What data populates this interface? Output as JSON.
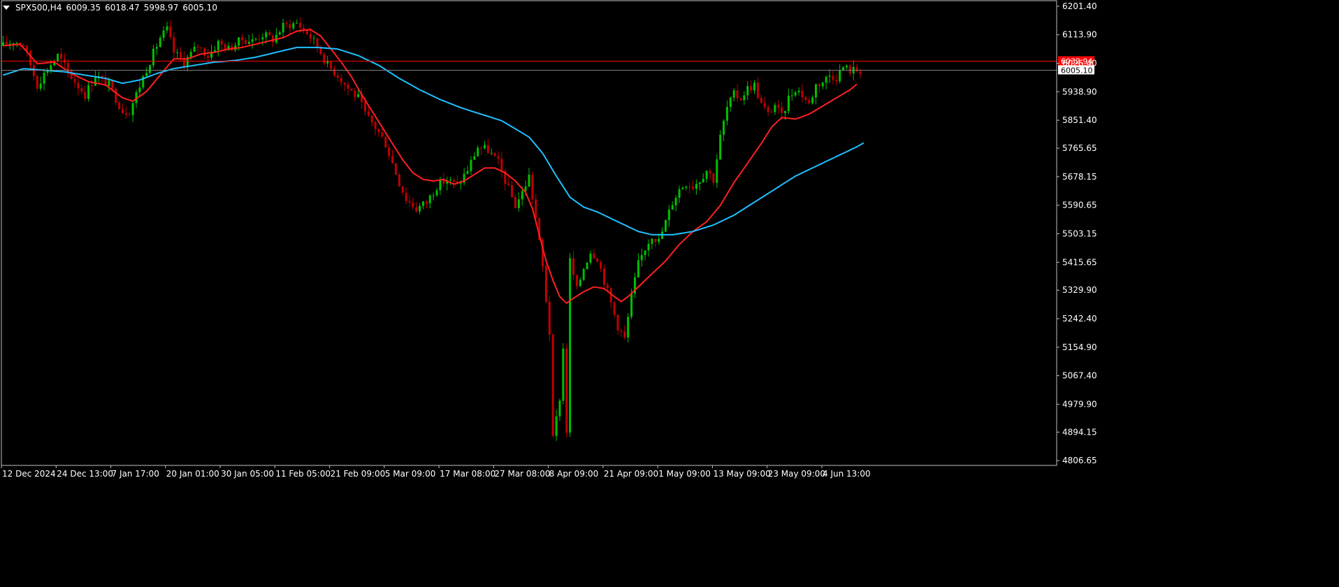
{
  "header": {
    "symbol": "SPX500,H4",
    "open": "6009.35",
    "high": "6018.47",
    "low": "5998.97",
    "close": "6005.10"
  },
  "colors": {
    "background": "#000000",
    "axis": "#c0c0c0",
    "candle_up": "#00c000",
    "candle_down": "#c00000",
    "ma_fast": "#ff2020",
    "ma_slow": "#20c0ff",
    "level_line": "#ff0000",
    "price_line": "#808080",
    "level_label_bg": "#ff0000",
    "price_label_bg": "#ffffff"
  },
  "chart_data": {
    "type": "line",
    "title": "",
    "y_ticks": [
      "6201.40",
      "6113.90",
      "6026.40",
      "5938.90",
      "5851.40",
      "5765.65",
      "5678.15",
      "5590.65",
      "5503.15",
      "5415.65",
      "5329.90",
      "5242.40",
      "5154.90",
      "5067.40",
      "4979.90",
      "4894.15",
      "4806.65"
    ],
    "ylim": [
      4792,
      6212
    ],
    "x_ticks": [
      "12 Dec 2024",
      "24 Dec 13:00",
      "7 Jan 17:00",
      "20 Jan 01:00",
      "30 Jan 05:00",
      "11 Feb 05:00",
      "21 Feb 09:00",
      "5 Mar 09:00",
      "17 Mar 08:00",
      "27 Mar 08:00",
      "8 Apr 09:00",
      "21 Apr 09:00",
      "1 May 09:00",
      "13 May 09:00",
      "23 May 09:00",
      "4 Jun 13:00"
    ],
    "horizontal_levels": [
      {
        "name": "level",
        "value": 6032.94,
        "label": "6032.94"
      },
      {
        "name": "bid",
        "value": 6005.1,
        "label": "6005.10"
      }
    ],
    "price_close_keypoints": [
      [
        0,
        6080
      ],
      [
        3,
        6095
      ],
      [
        6,
        6085
      ],
      [
        10,
        5960
      ],
      [
        13,
        6010
      ],
      [
        16,
        6050
      ],
      [
        20,
        5985
      ],
      [
        24,
        5930
      ],
      [
        27,
        5990
      ],
      [
        31,
        5960
      ],
      [
        35,
        5880
      ],
      [
        37,
        5880
      ],
      [
        42,
        6010
      ],
      [
        46,
        6105
      ],
      [
        48,
        6130
      ],
      [
        50,
        6060
      ],
      [
        53,
        6030
      ],
      [
        57,
        6080
      ],
      [
        60,
        6050
      ],
      [
        63,
        6090
      ],
      [
        66,
        6070
      ],
      [
        70,
        6100
      ],
      [
        73,
        6095
      ],
      [
        76,
        6115
      ],
      [
        79,
        6100
      ],
      [
        82,
        6140
      ],
      [
        86,
        6150
      ],
      [
        89,
        6120
      ],
      [
        92,
        6080
      ],
      [
        95,
        6020
      ],
      [
        98,
        5990
      ],
      [
        101,
        5950
      ],
      [
        104,
        5920
      ],
      [
        106,
        5870
      ],
      [
        109,
        5830
      ],
      [
        112,
        5780
      ],
      [
        114,
        5720
      ],
      [
        116,
        5660
      ],
      [
        118,
        5610
      ],
      [
        121,
        5580
      ],
      [
        124,
        5600
      ],
      [
        127,
        5650
      ],
      [
        130,
        5670
      ],
      [
        133,
        5650
      ],
      [
        136,
        5700
      ],
      [
        139,
        5770
      ],
      [
        142,
        5760
      ],
      [
        145,
        5720
      ],
      [
        148,
        5640
      ],
      [
        150,
        5590
      ],
      [
        152,
        5630
      ],
      [
        154,
        5680
      ],
      [
        156,
        5550
      ],
      [
        158,
        5400
      ],
      [
        160,
        5200
      ],
      [
        161,
        4870
      ],
      [
        163,
        5000
      ],
      [
        164,
        5150
      ],
      [
        165,
        4900
      ],
      [
        166,
        5420
      ],
      [
        168,
        5330
      ],
      [
        170,
        5400
      ],
      [
        172,
        5450
      ],
      [
        174,
        5430
      ],
      [
        176,
        5360
      ],
      [
        178,
        5290
      ],
      [
        180,
        5220
      ],
      [
        182,
        5180
      ],
      [
        184,
        5310
      ],
      [
        186,
        5410
      ],
      [
        188,
        5460
      ],
      [
        190,
        5500
      ],
      [
        192,
        5480
      ],
      [
        194,
        5540
      ],
      [
        196,
        5600
      ],
      [
        198,
        5640
      ],
      [
        200,
        5660
      ],
      [
        202,
        5650
      ],
      [
        204,
        5670
      ],
      [
        206,
        5700
      ],
      [
        208,
        5670
      ],
      [
        210,
        5800
      ],
      [
        212,
        5890
      ],
      [
        214,
        5930
      ],
      [
        216,
        5920
      ],
      [
        218,
        5950
      ],
      [
        220,
        5960
      ],
      [
        222,
        5900
      ],
      [
        224,
        5870
      ],
      [
        226,
        5900
      ],
      [
        228,
        5860
      ],
      [
        230,
        5920
      ],
      [
        232,
        5950
      ],
      [
        234,
        5930
      ],
      [
        236,
        5900
      ],
      [
        238,
        5960
      ],
      [
        240,
        5970
      ],
      [
        242,
        5990
      ],
      [
        244,
        5985
      ],
      [
        246,
        6015
      ],
      [
        248,
        6005
      ]
    ],
    "series": [
      {
        "color": "#ff2020",
        "keypoints": [
          [
            0,
            6080
          ],
          [
            5,
            6085
          ],
          [
            10,
            6025
          ],
          [
            15,
            6030
          ],
          [
            20,
            5995
          ],
          [
            25,
            5970
          ],
          [
            30,
            5960
          ],
          [
            35,
            5920
          ],
          [
            38,
            5910
          ],
          [
            42,
            5940
          ],
          [
            46,
            5990
          ],
          [
            50,
            6040
          ],
          [
            54,
            6040
          ],
          [
            58,
            6055
          ],
          [
            62,
            6060
          ],
          [
            66,
            6070
          ],
          [
            70,
            6075
          ],
          [
            74,
            6085
          ],
          [
            78,
            6095
          ],
          [
            82,
            6105
          ],
          [
            86,
            6125
          ],
          [
            90,
            6130
          ],
          [
            93,
            6110
          ],
          [
            96,
            6070
          ],
          [
            99,
            6030
          ],
          [
            102,
            5985
          ],
          [
            105,
            5930
          ],
          [
            108,
            5880
          ],
          [
            111,
            5830
          ],
          [
            114,
            5780
          ],
          [
            117,
            5730
          ],
          [
            120,
            5690
          ],
          [
            123,
            5670
          ],
          [
            126,
            5665
          ],
          [
            129,
            5670
          ],
          [
            132,
            5655
          ],
          [
            135,
            5665
          ],
          [
            138,
            5685
          ],
          [
            141,
            5705
          ],
          [
            144,
            5705
          ],
          [
            147,
            5690
          ],
          [
            150,
            5665
          ],
          [
            153,
            5630
          ],
          [
            155,
            5580
          ],
          [
            157,
            5500
          ],
          [
            159,
            5420
          ],
          [
            161,
            5360
          ],
          [
            163,
            5310
          ],
          [
            165,
            5290
          ],
          [
            167,
            5305
          ],
          [
            170,
            5325
          ],
          [
            173,
            5340
          ],
          [
            176,
            5335
          ],
          [
            179,
            5310
          ],
          [
            181,
            5295
          ],
          [
            183,
            5310
          ],
          [
            186,
            5340
          ],
          [
            190,
            5380
          ],
          [
            194,
            5420
          ],
          [
            198,
            5470
          ],
          [
            202,
            5510
          ],
          [
            206,
            5540
          ],
          [
            210,
            5590
          ],
          [
            214,
            5660
          ],
          [
            218,
            5720
          ],
          [
            222,
            5780
          ],
          [
            225,
            5830
          ],
          [
            228,
            5860
          ],
          [
            232,
            5855
          ],
          [
            236,
            5870
          ],
          [
            240,
            5895
          ],
          [
            244,
            5920
          ],
          [
            248,
            5945
          ],
          [
            250,
            5962
          ]
        ]
      },
      {
        "color": "#20c0ff",
        "keypoints": [
          [
            0,
            5990
          ],
          [
            6,
            6010
          ],
          [
            12,
            6005
          ],
          [
            18,
            6000
          ],
          [
            24,
            5990
          ],
          [
            30,
            5980
          ],
          [
            35,
            5965
          ],
          [
            40,
            5975
          ],
          [
            45,
            5995
          ],
          [
            50,
            6010
          ],
          [
            56,
            6020
          ],
          [
            62,
            6030
          ],
          [
            68,
            6035
          ],
          [
            74,
            6045
          ],
          [
            80,
            6060
          ],
          [
            86,
            6075
          ],
          [
            92,
            6075
          ],
          [
            98,
            6070
          ],
          [
            104,
            6050
          ],
          [
            110,
            6020
          ],
          [
            116,
            5980
          ],
          [
            122,
            5945
          ],
          [
            128,
            5915
          ],
          [
            134,
            5890
          ],
          [
            140,
            5870
          ],
          [
            146,
            5850
          ],
          [
            150,
            5825
          ],
          [
            154,
            5800
          ],
          [
            158,
            5750
          ],
          [
            162,
            5680
          ],
          [
            166,
            5615
          ],
          [
            170,
            5585
          ],
          [
            174,
            5570
          ],
          [
            178,
            5550
          ],
          [
            182,
            5530
          ],
          [
            186,
            5510
          ],
          [
            190,
            5500
          ],
          [
            196,
            5500
          ],
          [
            202,
            5510
          ],
          [
            208,
            5530
          ],
          [
            214,
            5560
          ],
          [
            220,
            5600
          ],
          [
            226,
            5640
          ],
          [
            232,
            5680
          ],
          [
            238,
            5710
          ],
          [
            244,
            5740
          ],
          [
            250,
            5770
          ],
          [
            252,
            5782
          ]
        ]
      }
    ]
  }
}
